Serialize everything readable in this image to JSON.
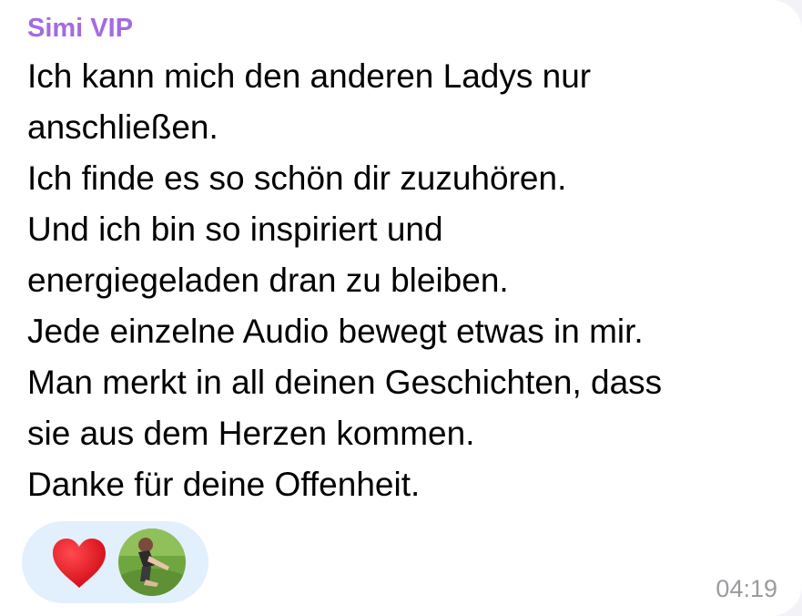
{
  "message": {
    "sender": "Simi VIP",
    "lines": [
      "Ich kann mich den anderen Ladys nur",
      "anschließen.",
      "Ich finde es so schön dir zuzuhören.",
      "Und ich bin so inspiriert und",
      "energiegeladen dran zu bleiben.",
      "Jede einzelne Audio bewegt etwas in mir.",
      "Man merkt in all deinen Geschichten, dass",
      "sie aus dem Herzen kommen.",
      "Danke für deine Offenheit."
    ],
    "time": "04:19"
  },
  "reaction": {
    "emoji_icon": "red-heart-icon",
    "reactor_avatar": "user-avatar"
  },
  "colors": {
    "sender": "#a36be0",
    "reaction_background": "#e2effd",
    "heart": "#e3121d",
    "timestamp": "#9a9aa0"
  }
}
